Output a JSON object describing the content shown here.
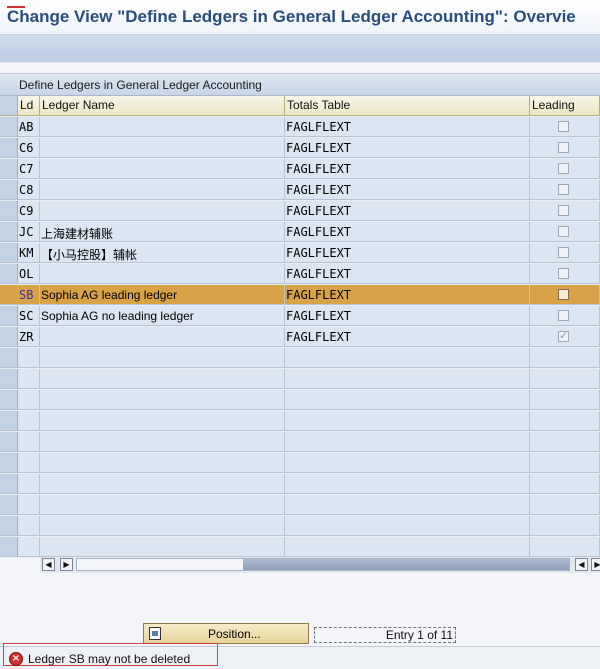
{
  "window": {
    "title": "Change View \"Define Ledgers in General Ledger Accounting\": Overvie"
  },
  "table": {
    "title": "Define Ledgers in General Ledger Accounting",
    "columns": {
      "ld": "Ld",
      "name": "Ledger Name",
      "totals": "Totals Table",
      "leading": "Leading"
    },
    "rows": [
      {
        "ld": "AB",
        "name": "",
        "totals": "FAGLFLEXT",
        "leading": false
      },
      {
        "ld": "C6",
        "name": "",
        "totals": "FAGLFLEXT",
        "leading": false
      },
      {
        "ld": "C7",
        "name": "",
        "totals": "FAGLFLEXT",
        "leading": false
      },
      {
        "ld": "C8",
        "name": "",
        "totals": "FAGLFLEXT",
        "leading": false
      },
      {
        "ld": "C9",
        "name": "",
        "totals": "FAGLFLEXT",
        "leading": false
      },
      {
        "ld": "JC",
        "name": "上海建材辅账",
        "totals": "FAGLFLEXT",
        "leading": false
      },
      {
        "ld": "KM",
        "name": "【小马控股】辅帐",
        "totals": "FAGLFLEXT",
        "leading": false
      },
      {
        "ld": "OL",
        "name": "",
        "totals": "FAGLFLEXT",
        "leading": false
      },
      {
        "ld": "SB",
        "name": "Sophia AG leading ledger",
        "totals": "FAGLFLEXT",
        "leading": false,
        "selected": true
      },
      {
        "ld": "SC",
        "name": "Sophia AG no leading ledger",
        "totals": "FAGLFLEXT",
        "leading": false
      },
      {
        "ld": "ZR",
        "name": "",
        "totals": "FAGLFLEXT",
        "leading": true
      }
    ],
    "empty_rows": 10
  },
  "scroll": {
    "left_icon": "arrow-left-icon",
    "right_icon": "arrow-right-icon"
  },
  "footer": {
    "position_button": "Position...",
    "entry_text": "Entry 1 of 11"
  },
  "status": {
    "icon": "error-icon",
    "message": "Ledger SB may not be deleted"
  },
  "colors": {
    "title": "#2a4d7c",
    "selected_row": "#d8a347",
    "error": "#d32f2f"
  }
}
